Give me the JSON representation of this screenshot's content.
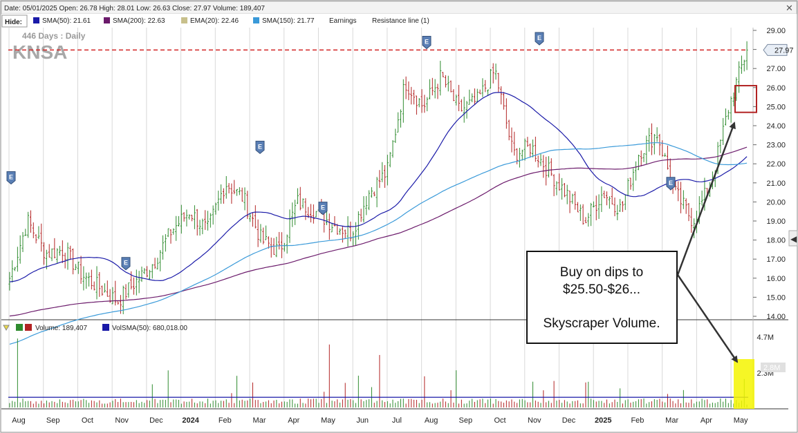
{
  "header": {
    "info": "Date: 05/01/2025  Open: 26.78  High: 28.01  Low: 26.63  Close: 27.97  Volume: 189,407",
    "hide_label": "Hide:",
    "legend": [
      {
        "label": "SMA(50): 21.61",
        "color": "#1a1aa8"
      },
      {
        "label": "SMA(200): 22.63",
        "color": "#6b1a6b"
      },
      {
        "label": "EMA(20): 22.46",
        "color": "#c8c08c"
      },
      {
        "label": "SMA(150): 21.77",
        "color": "#3a9ad9"
      },
      {
        "label": "Earnings",
        "color": ""
      },
      {
        "label": "Resistance line (1)",
        "color": ""
      }
    ]
  },
  "price_panel": {
    "period": "446  Days : Daily",
    "symbol": "KNSA",
    "last_price": "27.97",
    "y_ticks": [
      "29.00",
      "28.00",
      "27.00",
      "26.00",
      "25.00",
      "24.00",
      "23.00",
      "22.00",
      "21.00",
      "20.00",
      "19.00",
      "18.00",
      "17.00",
      "16.00",
      "15.00",
      "14.00"
    ],
    "earnings_marker": "E"
  },
  "volume_panel": {
    "volume_label": "Volume: 189,407",
    "volsma_label": "VolSMA(50): 680,018.00",
    "y_ticks": [
      "4.7M",
      "2.3M"
    ],
    "highlight_value": "2.8M"
  },
  "annotation": {
    "line1": "Buy on dips to",
    "line2": "$25.50-$26...",
    "line3": "Skyscraper Volume."
  },
  "x_axis": [
    "Aug",
    "Sep",
    "Oct",
    "Nov",
    "Dec",
    "2024",
    "Feb",
    "Mar",
    "Apr",
    "May",
    "Jun",
    "Jul",
    "Aug",
    "Sep",
    "Oct",
    "Nov",
    "Dec",
    "2025",
    "Feb",
    "Mar",
    "Apr",
    "May"
  ],
  "colors": {
    "up_bar": "#2e8b2e",
    "down_bar": "#b22222",
    "resistance": "#d22222",
    "sma50": "#1a1aa8",
    "sma200": "#6b1a6b",
    "sma150": "#3a9ad9",
    "volume_highlight": "#f5f500",
    "buy_zone": "#b22222"
  },
  "chart_data": {
    "type": "candlestick",
    "symbol": "KNSA",
    "period": "446 Days : Daily",
    "ylim": [
      14,
      29
    ],
    "resistance_level": 27.97,
    "buy_zone": [
      25.5,
      26
    ],
    "last": {
      "date": "05/01/2025",
      "open": 26.78,
      "high": 28.01,
      "low": 26.63,
      "close": 27.97,
      "volume": 189407
    },
    "price_series": {
      "name": "Close (approx.)",
      "points": [
        [
          "Aug",
          16.0
        ],
        [
          "Aug",
          19.0
        ],
        [
          "Sep",
          17.3
        ],
        [
          "Oct",
          17.5
        ],
        [
          "Oct",
          16.2
        ],
        [
          "Nov",
          15.5
        ],
        [
          "Nov",
          14.8
        ],
        [
          "Dec",
          15.8
        ],
        [
          "Dec",
          16.8
        ],
        [
          "2024",
          18.5
        ],
        [
          "Feb",
          19.5
        ],
        [
          "Feb",
          18.5
        ],
        [
          "Mar",
          21.0
        ],
        [
          "Mar",
          20.2
        ],
        [
          "Apr",
          18.0
        ],
        [
          "Apr",
          17.4
        ],
        [
          "May",
          20.0
        ],
        [
          "May",
          19.5
        ],
        [
          "Jun",
          18.8
        ],
        [
          "Jun",
          18.4
        ],
        [
          "Jul",
          20.5
        ],
        [
          "Jul",
          21.6
        ],
        [
          "Aug",
          26.3
        ],
        [
          "Aug",
          25.0
        ],
        [
          "Sep",
          26.6
        ],
        [
          "Sep",
          24.8
        ],
        [
          "Oct",
          25.3
        ],
        [
          "Oct",
          26.9
        ],
        [
          "Nov",
          22.5
        ],
        [
          "Nov",
          22.9
        ],
        [
          "Dec",
          21.6
        ],
        [
          "Dec",
          20.4
        ],
        [
          "2025",
          19.0
        ],
        [
          "Feb",
          20.5
        ],
        [
          "Feb",
          19.6
        ],
        [
          "Mar",
          22.6
        ],
        [
          "Mar",
          23.6
        ],
        [
          "Apr",
          20.5
        ],
        [
          "Apr",
          19.0
        ],
        [
          "Apr",
          21.0
        ],
        [
          "May",
          25.0
        ],
        [
          "May",
          27.97
        ]
      ]
    },
    "moving_averages": [
      {
        "name": "SMA(50)",
        "last": 21.61
      },
      {
        "name": "SMA(200)",
        "last": 22.63
      },
      {
        "name": "EMA(20)",
        "last": 22.46
      },
      {
        "name": "SMA(150)",
        "last": 21.77
      }
    ],
    "earnings_markers": [
      "Aug",
      "Nov",
      "Mar",
      "May",
      "Aug",
      "Nov",
      "Feb"
    ],
    "volume": {
      "last": 189407,
      "volsma50": 680018.0,
      "ylim": [
        0,
        4700000
      ],
      "highlight_label": "2.8M"
    }
  }
}
